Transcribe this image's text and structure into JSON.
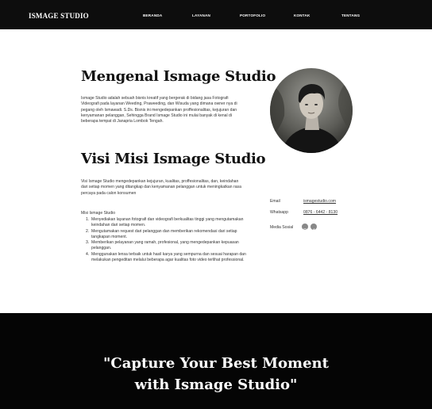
{
  "header": {
    "brand": "ISMAGE STUDIO",
    "nav": [
      "BERANDA",
      "LAYANAN",
      "PORTOFOLIO",
      "KONTAK",
      "TENTANG"
    ]
  },
  "about": {
    "title": "Mengenal Ismage Studio",
    "description": "Ismage Studio adalah sebuah bisnis kreatif yang bergerak di bidang jasa Fotografi Videografi pada layanan Weeding, Praweeding, dan Wisuda yang dimana owner nya di pegang oleh Ismawadi. S.Ds. Bisnis ini mengedepankan proffesionalitas, kejujuran dan kenyamanan pelanggan, Sehingga Brand Ismage Studio ini mulai banyak di kenal di beberapa tempat di Janapria Lombok Tengah."
  },
  "visi_misi": {
    "title": "Visi Misi Ismage Studio",
    "visi": "Visi Ismage Studio mengedepankan kejujuran, kualitas, proffesionalitas, dan, keindahan dari setiap momen yang ditangkap dan kenyamanan pelanggan untuk meningkatkan rasa percaya pada calon konsumen",
    "misi_label": "Misi Ismage Studio",
    "misi": [
      {
        "n": "1.",
        "text": "Menyediakan layanan fotografi dan videografi berkualitas tinggi yang mengutamakan keindahan dari setiap momen."
      },
      {
        "n": "2.",
        "text": "Mengutamakan request dari pelanggan dan memberikan rekomendasi dari setiap tangkapan moment."
      },
      {
        "n": "3.",
        "text": "Memberikan pelayanan yang ramah, profesional, yang mengedepankan kepuasan pelanggan."
      },
      {
        "n": "4.",
        "text": "Menggunakan lensa terbaik untuk hasil karya yang sempurna dan sesuai harapan dan melakukan pengeditan melalui beberapa agar kualitas foto video terlihat professional."
      }
    ]
  },
  "contact": {
    "email_label": "Email",
    "email_value": "ismagestudio.com",
    "whatsapp_label": "Whatsapp",
    "whatsapp_value": "0876 - 6442 - 8130",
    "social_label": "Media Sosial",
    "social_icons": [
      "instagram-icon",
      "facebook-icon"
    ]
  },
  "footer": {
    "quote_line1": "\"Capture Your Best Moment",
    "quote_line2": "with Ismage Studio\""
  },
  "colors": {
    "header_bg": "#0d0d0d",
    "footer_bg": "#050505",
    "text": "#222222"
  }
}
